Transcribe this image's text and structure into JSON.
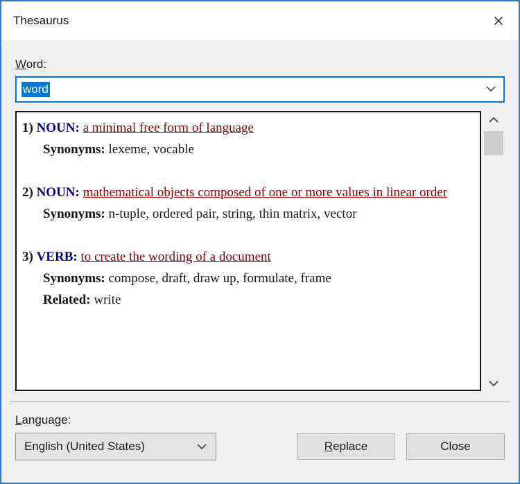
{
  "window": {
    "title": "Thesaurus",
    "close_icon": "close-x"
  },
  "word_field": {
    "label": {
      "pre": "",
      "key": "W",
      "post": "ord:"
    },
    "value": "word",
    "selection": "full"
  },
  "thesaurus": {
    "entries": [
      {
        "number": "1)",
        "pos": "NOUN:",
        "definition": "a minimal free form of language",
        "details": [
          {
            "label": "Synonyms:",
            "text": "lexeme, vocable"
          }
        ]
      },
      {
        "number": "2)",
        "pos": "NOUN:",
        "definition": "mathematical objects composed of one or more values in linear order",
        "details": [
          {
            "label": "Synonyms:",
            "text": "n-tuple, ordered pair, string, thin matrix, vector"
          }
        ]
      },
      {
        "number": "3)",
        "pos": "VERB:",
        "definition": "to create the wording of a document",
        "details": [
          {
            "label": "Synonyms:",
            "text": "compose, draft, draw up, formulate, frame"
          },
          {
            "label": "Related:",
            "text": "write"
          }
        ]
      }
    ]
  },
  "language_field": {
    "label": {
      "pre": "",
      "key": "L",
      "post": "anguage:"
    },
    "value": "English (United States)"
  },
  "buttons": {
    "replace": {
      "pre": "",
      "key": "R",
      "post": "eplace"
    },
    "close_label": "Close"
  },
  "icons": {
    "chevron_up": "chevron-up",
    "chevron_down": "chevron-down"
  },
  "colors": {
    "dialog_border": "#2b7bc4",
    "focus_border": "#0078d7",
    "selection": "#0078d7",
    "pos_color": "#00008b",
    "definition_link": "#8b0000",
    "scroll_thumb": "#cdcdcd",
    "dialog_bg": "#f0f0f0"
  }
}
